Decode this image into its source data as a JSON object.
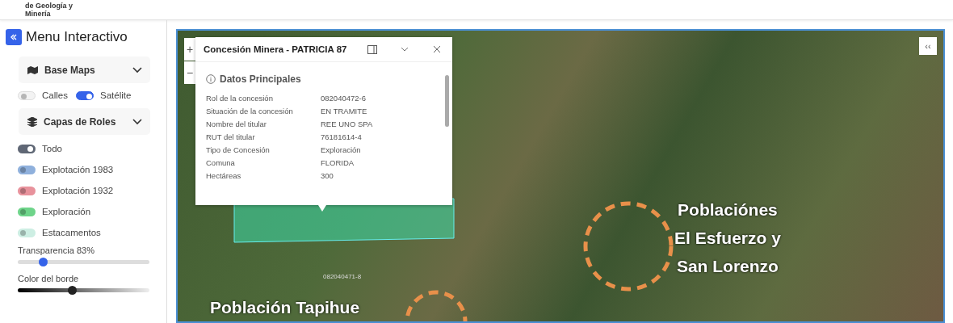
{
  "header": {
    "logo_lines": [
      "de Geología y",
      "Minería"
    ]
  },
  "sidebar": {
    "title": "Menu Interactivo",
    "base_maps": {
      "label": "Base Maps",
      "expanded": true,
      "options": [
        {
          "label": "Calles",
          "on": false
        },
        {
          "label": "Satélite",
          "on": true
        }
      ]
    },
    "layers": {
      "label": "Capas de Roles",
      "expanded": true,
      "items": [
        {
          "label": "Todo",
          "on": true,
          "color": "#5f6775"
        },
        {
          "label": "Explotación 1983",
          "on": false,
          "color": "#8fb0dc"
        },
        {
          "label": "Explotación 1932",
          "on": false,
          "color": "#e8929c"
        },
        {
          "label": "Exploración",
          "on": false,
          "color": "#6ed48a"
        },
        {
          "label": "Estacamentos",
          "on": false,
          "color": "#cdeee3"
        }
      ]
    },
    "transparency": {
      "label": "Transparencia 83%",
      "level": 0.19
    },
    "border_color": {
      "label": "Color del borde",
      "level": 0.41
    }
  },
  "map": {
    "zoom_in": "+",
    "zoom_out": "−",
    "collapse": "‹‹",
    "parcel_labels": [
      "082040471-8"
    ],
    "annotations": [
      {
        "lines": [
          "Poblaciónes",
          "El Esfuerzo y",
          "San Lorenzo"
        ]
      },
      {
        "lines": [
          "Población Tapihue"
        ]
      }
    ],
    "popup": {
      "title": "Concesión Minera - PATRICIA 87",
      "section": "Datos Principales",
      "fields": [
        {
          "label": "Rol de la concesión",
          "value": "082040472-6"
        },
        {
          "label": "Situación de la concesión",
          "value": "EN TRAMITE"
        },
        {
          "label": "Nombre del titular",
          "value": "REE UNO SPA"
        },
        {
          "label": "RUT del titular",
          "value": "76181614-4"
        },
        {
          "label": "Tipo de Concesión",
          "value": "Exploración"
        },
        {
          "label": "Comuna",
          "value": "FLORIDA"
        },
        {
          "label": "Hectáreas",
          "value": "300"
        }
      ]
    }
  }
}
